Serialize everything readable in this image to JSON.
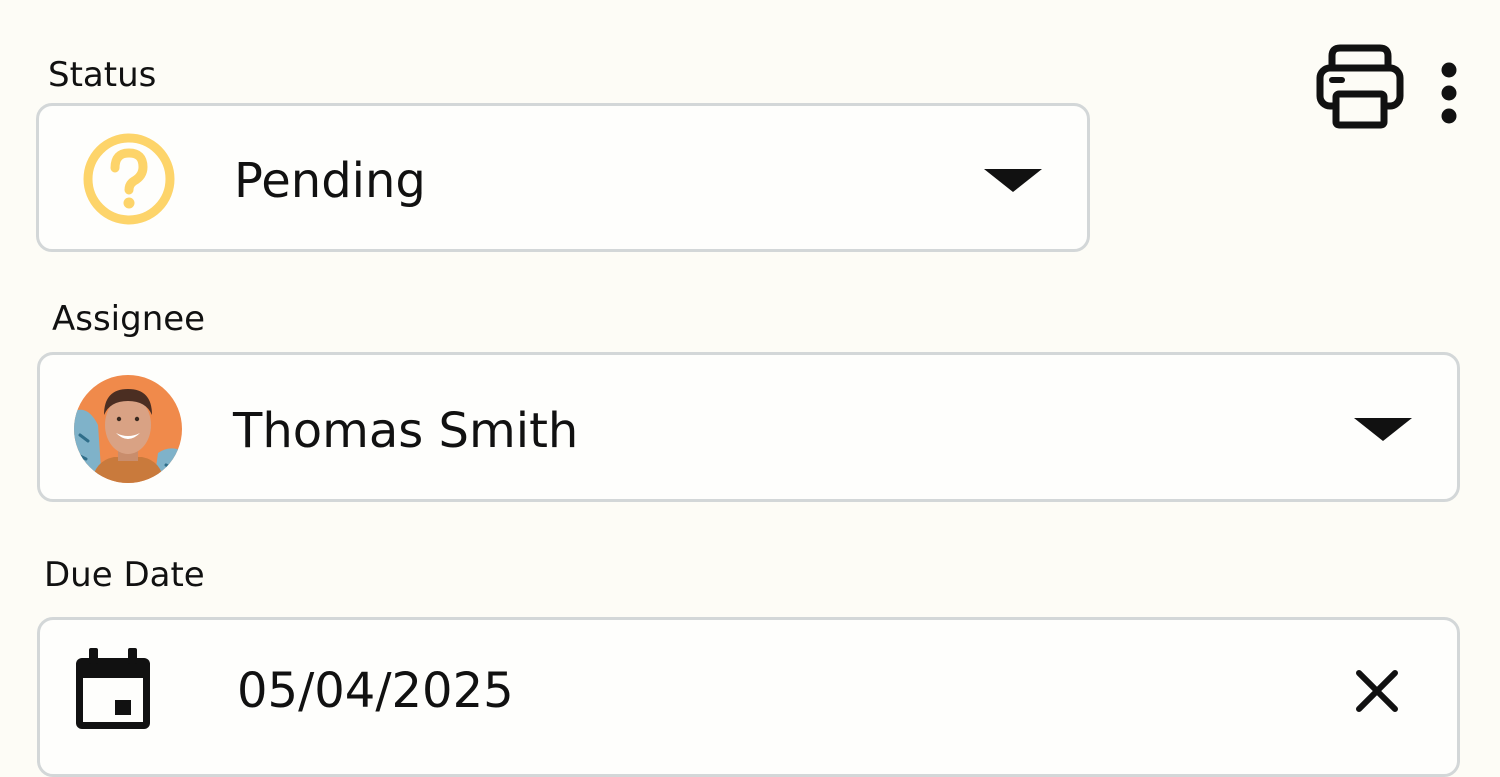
{
  "toolbar": {
    "print_icon": "printer-icon",
    "more_icon": "more-vertical-icon"
  },
  "status": {
    "label": "Status",
    "value": "Pending",
    "icon": "question-circle-icon",
    "icon_color": "#fdd46a"
  },
  "assignee": {
    "label": "Assignee",
    "value": "Thomas Smith",
    "avatar_bg": "#f08a4b"
  },
  "due_date": {
    "label": "Due Date",
    "value": "05/04/2025",
    "icon": "calendar-icon",
    "clear_icon": "close-icon"
  },
  "colors": {
    "background": "#fdfcf6",
    "border": "#d3d7d8",
    "text": "#111111"
  }
}
